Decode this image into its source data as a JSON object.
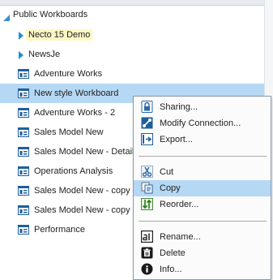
{
  "tree": {
    "root_label": "Public Workboards",
    "items": [
      {
        "label": "Necto 15 Demo",
        "type": "folder"
      },
      {
        "label": "NewsJe",
        "type": "folder"
      },
      {
        "label": "Adventure Works",
        "type": "workboard"
      },
      {
        "label": "New style  Workboard",
        "type": "workboard"
      },
      {
        "label": "Adventure Works - 2",
        "type": "workboard"
      },
      {
        "label": "Sales Model New",
        "type": "workboard"
      },
      {
        "label": "Sales Model New - Detail",
        "type": "workboard"
      },
      {
        "label": "Operations Analysis",
        "type": "workboard"
      },
      {
        "label": "Sales Model New - copy",
        "type": "workboard"
      },
      {
        "label": "Sales Model New - copy",
        "type": "workboard"
      },
      {
        "label": "Performance",
        "type": "workboard"
      }
    ]
  },
  "context_menu": {
    "items": [
      {
        "label": "Sharing...",
        "icon": "lock-icon"
      },
      {
        "label": "Modify Connection...",
        "icon": "connection-icon"
      },
      {
        "label": "Export...",
        "icon": "export-icon"
      },
      {
        "label": "Cut",
        "icon": "scissors-icon"
      },
      {
        "label": "Copy",
        "icon": "copy-icon"
      },
      {
        "label": "Reorder...",
        "icon": "reorder-icon"
      },
      {
        "label": "Rename...",
        "icon": "rename-icon"
      },
      {
        "label": "Delete",
        "icon": "trash-icon"
      },
      {
        "label": "Info...",
        "icon": "info-icon"
      }
    ]
  },
  "colors": {
    "hover_row": "#b5d8f5",
    "icon_blue": "#1f5f9e",
    "expander_blue": "#3e8ed0",
    "highlight_yellow": "#fdf7c4"
  }
}
